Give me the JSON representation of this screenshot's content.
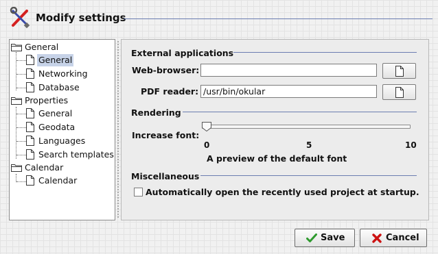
{
  "dialog": {
    "title": "Modify settings",
    "icon": "tools-icon"
  },
  "tree": {
    "groups": [
      {
        "label": "General",
        "icon": "folder-icon",
        "items": [
          {
            "label": "General",
            "icon": "page-icon",
            "selected": true
          },
          {
            "label": "Networking",
            "icon": "page-icon"
          },
          {
            "label": "Database",
            "icon": "page-icon"
          }
        ]
      },
      {
        "label": "Properties",
        "icon": "folder-icon",
        "items": [
          {
            "label": "General",
            "icon": "page-icon"
          },
          {
            "label": "Geodata",
            "icon": "page-icon"
          },
          {
            "label": "Languages",
            "icon": "page-icon"
          },
          {
            "label": "Search templates",
            "icon": "page-icon"
          }
        ]
      },
      {
        "label": "Calendar",
        "icon": "folder-icon",
        "items": [
          {
            "label": "Calendar",
            "icon": "page-icon"
          }
        ]
      }
    ]
  },
  "sections": {
    "external": {
      "title": "External applications",
      "web_browser_label": "Web-browser:",
      "web_browser_value": "",
      "pdf_reader_label": "PDF reader:",
      "pdf_reader_value": "/usr/bin/okular"
    },
    "rendering": {
      "title": "Rendering",
      "font_label": "Increase font:",
      "slider_min": 0,
      "slider_max": 10,
      "slider_value": 0,
      "tick_labels": [
        "0",
        "5",
        "10"
      ],
      "preview": "A preview of the default font"
    },
    "misc": {
      "title": "Miscellaneous",
      "auto_open_label": "Automatically open the recently used project at startup.",
      "auto_open_checked": false
    }
  },
  "buttons": {
    "save": "Save",
    "cancel": "Cancel"
  },
  "colors": {
    "accent_line": "#6a7cb0",
    "selection": "#c7d3e8",
    "save_check": "#2e9a2e",
    "cancel_x": "#cc1111"
  }
}
